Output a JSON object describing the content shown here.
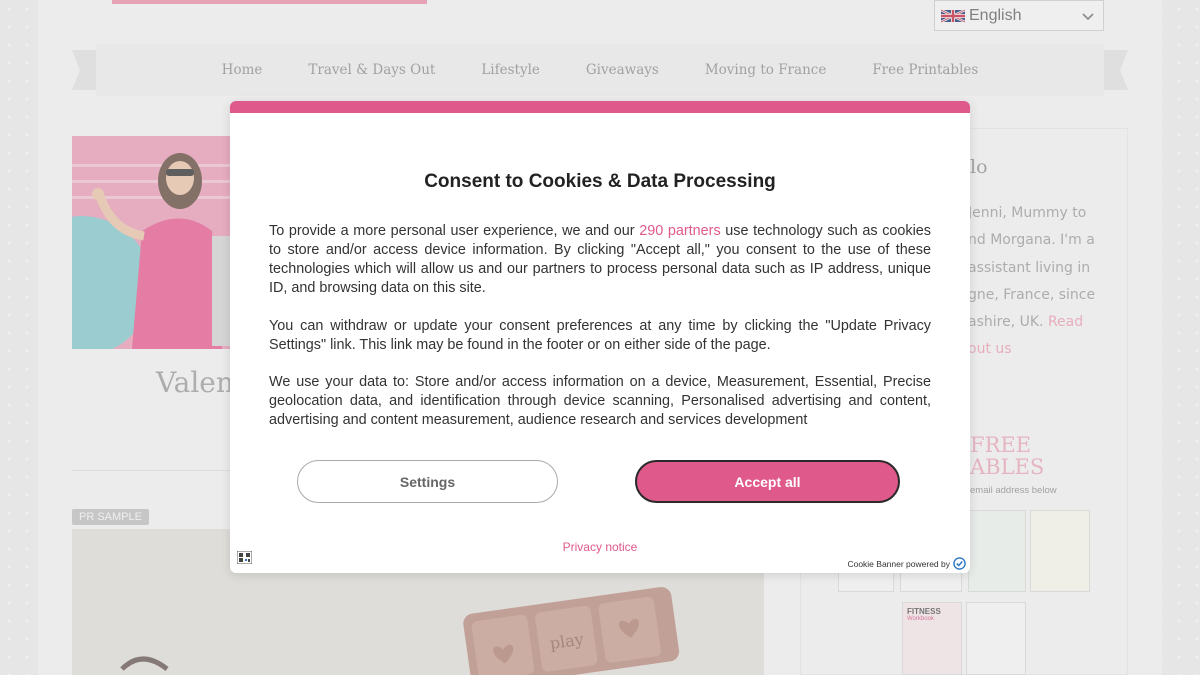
{
  "header": {
    "language": {
      "label": "English",
      "flag_icon": "uk-flag-icon"
    }
  },
  "nav": {
    "items": [
      {
        "label": "Home"
      },
      {
        "label": "Travel & Days Out"
      },
      {
        "label": "Lifestyle"
      },
      {
        "label": "Giveaways"
      },
      {
        "label": "Moving to France"
      },
      {
        "label": "Free Printables"
      }
    ]
  },
  "main": {
    "post_title": "Valen",
    "badge": "PR SAMPLE",
    "post2_chocolate_text": "play"
  },
  "sidebar": {
    "heading": "lo",
    "about_lines": [
      "Jenni, Mummy to",
      "nd Morgana. I'm a",
      "assistant living in",
      "gne, France, since",
      "ashire, UK."
    ],
    "read_link_1": "Read",
    "read_link_2": "out us",
    "free_line1": "FREE",
    "free_line2": "ABLES",
    "email_note": "email address below",
    "thumb_title": "FITNESS",
    "thumb_sub": "Workbook"
  },
  "cookie_modal": {
    "title": "Consent to Cookies & Data Processing",
    "p1_before": "To provide a more personal user experience, we and our ",
    "p1_partners": "290 partners",
    "p1_after": " use technology such as cookies to store and/or access device information. By clicking \"Accept all,\" you consent to the use of these technologies which will allow us and our partners to process personal data such as IP address, unique ID, and browsing data on this site.",
    "p2": "You can withdraw or update your consent preferences at any time by clicking the \"Update Privacy Settings\" link. This link may be found in the footer or on either side of the page.",
    "p3": "We use your data to: Store and/or access information on a device, Measurement, Essential, Precise geolocation data, and identification through device scanning, Personalised advertising and content, advertising and content measurement, audience research and services development",
    "settings_label": "Settings",
    "accept_label": "Accept all",
    "privacy_label": "Privacy notice",
    "powered_by": "Cookie Banner powered by"
  },
  "colors": {
    "accent_pink": "#e0598b",
    "link_pink": "#f29bb3"
  }
}
